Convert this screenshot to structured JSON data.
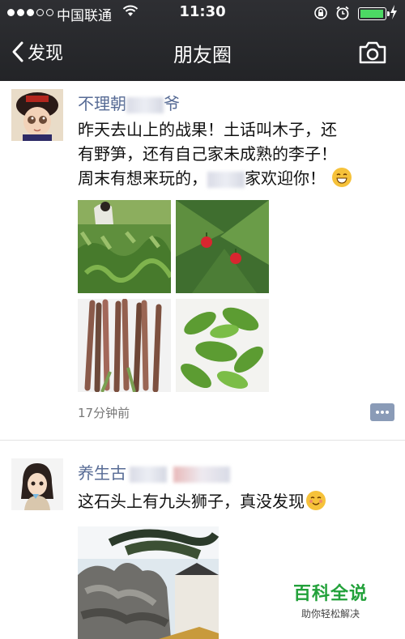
{
  "status_bar": {
    "carrier": "中国联通",
    "time": "11:30",
    "battery_level": 0.95,
    "signal_bars": 3
  },
  "nav": {
    "back_label": "发现",
    "title": "朋友圈"
  },
  "posts": [
    {
      "author_prefix": "不理朝",
      "author_suffix": "爷",
      "text_line1": "昨天去山上的战果！土话叫木子，还",
      "text_line2": "有野笋，还有自己家未成熟的李子！",
      "text_line3a": "周末有想来玩的，",
      "text_line3b": "家欢迎你！",
      "time_ago": "17分钟前"
    },
    {
      "author_prefix": "养生古",
      "text": "这石头上有九头狮子，真没发现"
    }
  ],
  "watermark": {
    "title": "百科全说",
    "subtitle": "助你轻松解决"
  },
  "colors": {
    "topbar": "#2a2b2f",
    "author_link": "#576b95",
    "battery": "#4cd964",
    "watermark": "#22a13a"
  }
}
